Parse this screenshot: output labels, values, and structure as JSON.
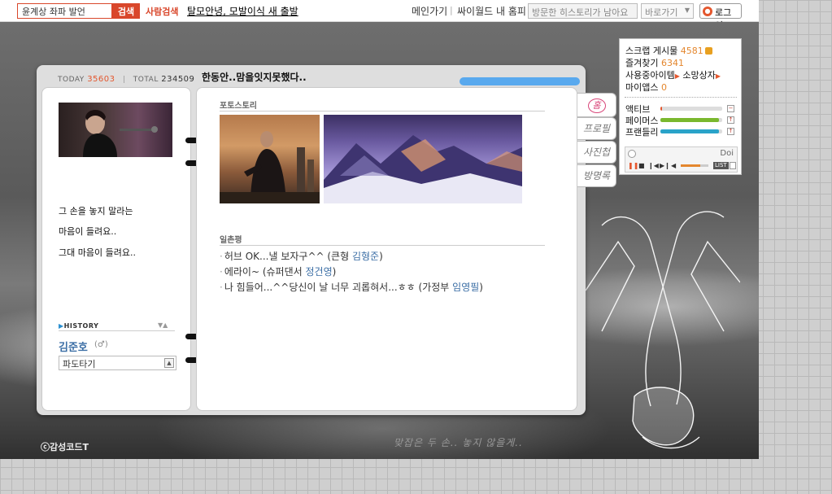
{
  "topbar": {
    "search_value": "윤계상 좌파 발언",
    "search_button": "검색",
    "people_search": "사람검색",
    "news": "탈모안녕, 모발이식 새 출발",
    "main_link": "메인가기",
    "separator": "|",
    "my_home": "싸이월드 내 홈피",
    "visited_history": "방문한 히스토리가 남아요",
    "goto_label": "바로가기",
    "login": "로그인"
  },
  "minihompy": {
    "counter": {
      "today_label": "TODAY",
      "today_value": "35603",
      "separator": "|",
      "total_label": "TOTAL",
      "total_value": "234509"
    },
    "title_message": "한동안..맘을잇지못했다..",
    "profile": {
      "lines": [
        "그 손을 놓지 말라는",
        "마음이 들려요..",
        "그대 마음이 들려요.."
      ],
      "history_label": "HISTORY",
      "owner_name": "김준호",
      "owner_gender": "(♂)",
      "mood": "파도타기"
    },
    "photo_story_title": "포토스토리",
    "comments_title": "일촌평",
    "comments": [
      {
        "text": "허브 OK...낼 보자구^^ (큰형 ",
        "friend": "김형준",
        "close": ")"
      },
      {
        "text": "에라이~ (슈퍼댄서 ",
        "friend": "정건영",
        "close": ")"
      },
      {
        "text": "나 힘들어...^^당신이 날 너무 괴롭혀서...ㅎㅎ (가정부 ",
        "friend": "임영필",
        "close": ")"
      }
    ],
    "tabs": [
      "홈",
      "프로필",
      "사진첩",
      "방명록"
    ],
    "stats": {
      "scrap_label": "스크랩 게시물",
      "scrap_value": "4581",
      "favorites_label": "즐겨찾기",
      "favorites_value": "6341",
      "items_label": "사용중아이템",
      "wish_label": "소망상자",
      "myapps_label": "마이앱스",
      "myapps_value": "0",
      "bars": [
        {
          "label": "액티브",
          "level": 0.02,
          "color": "#e4572e",
          "button": "−"
        },
        {
          "label": "페이머스",
          "level": 0.95,
          "color": "#7ab82e",
          "button": "↑"
        },
        {
          "label": "프랜들리",
          "level": 0.95,
          "color": "#2aa3c9",
          "button": "↑"
        }
      ],
      "player_title": "Doi",
      "player_list": "LIST"
    },
    "copyright": "ⓒ감성코드T",
    "bottom_quote": "맞잡은 두 손.. 놓지 않을게.."
  }
}
